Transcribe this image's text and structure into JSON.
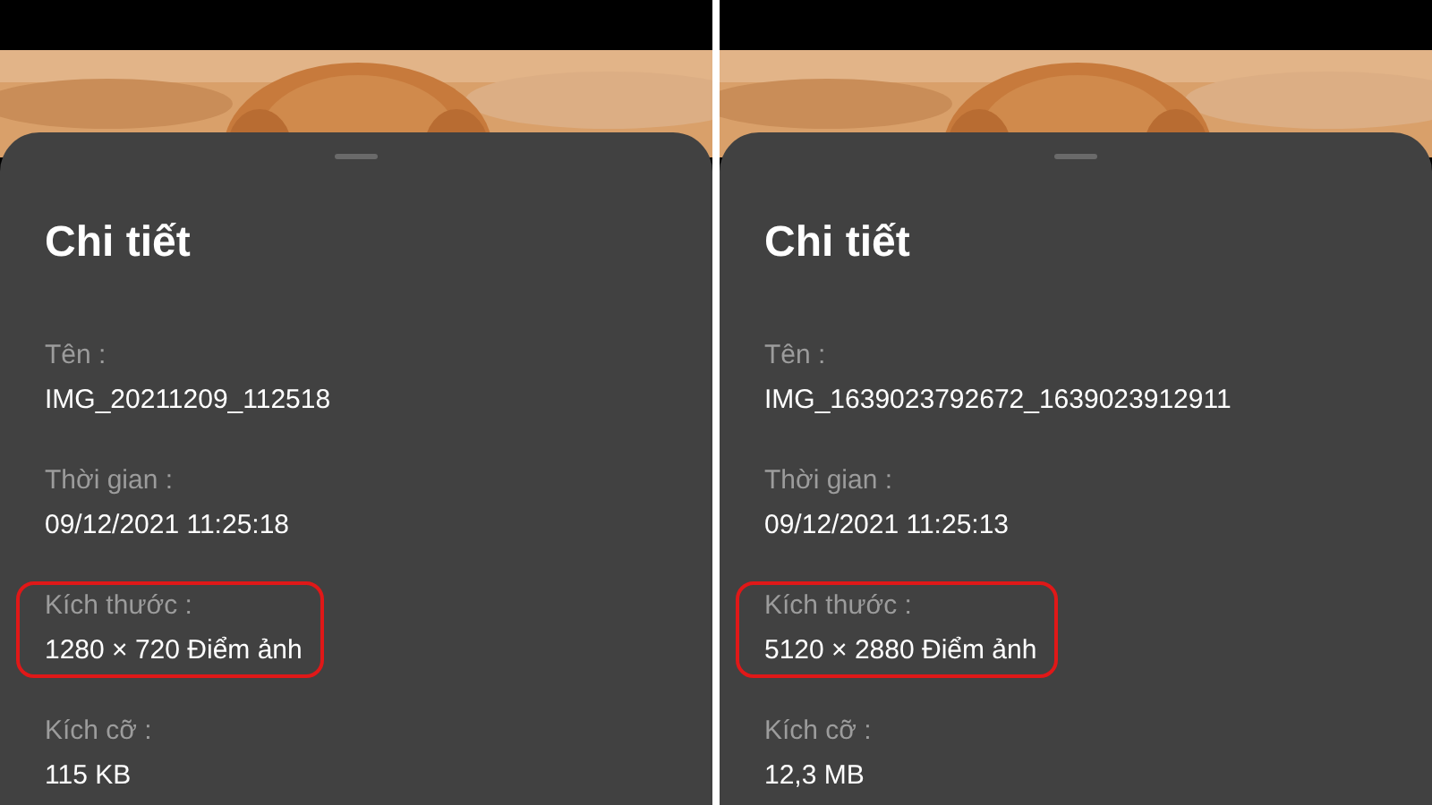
{
  "panels": [
    {
      "title": "Chi tiết",
      "fields": [
        {
          "label": "Tên :",
          "value": "IMG_20211209_112518",
          "highlighted": false
        },
        {
          "label": "Thời gian :",
          "value": "09/12/2021 11:25:18",
          "highlighted": false
        },
        {
          "label": "Kích thước :",
          "value": "1280 × 720 Điểm ảnh",
          "highlighted": true
        },
        {
          "label": "Kích cỡ :",
          "value": "115 KB",
          "highlighted": false
        }
      ]
    },
    {
      "title": "Chi tiết",
      "fields": [
        {
          "label": "Tên :",
          "value": "IMG_1639023792672_1639023912911",
          "highlighted": false
        },
        {
          "label": "Thời gian :",
          "value": "09/12/2021 11:25:13",
          "highlighted": false
        },
        {
          "label": "Kích thước :",
          "value": "5120 × 2880 Điểm ảnh",
          "highlighted": true
        },
        {
          "label": "Kích cỡ :",
          "value": "12,3 MB",
          "highlighted": false
        }
      ]
    }
  ]
}
